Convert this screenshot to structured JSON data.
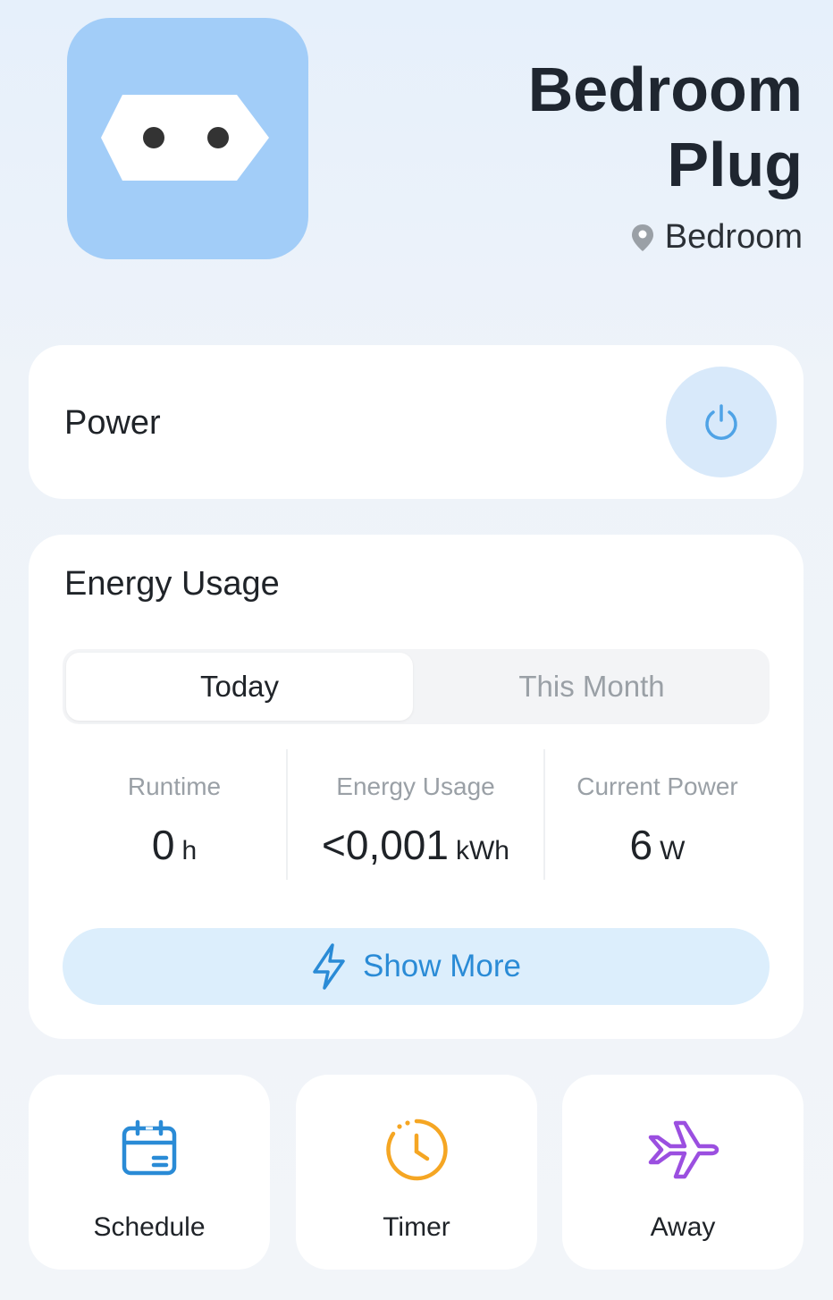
{
  "device": {
    "title_line1": "Bedroom",
    "title_line2": "Plug",
    "location": "Bedroom",
    "icon": "plug-icon",
    "location_icon": "location-pin-icon"
  },
  "power": {
    "label": "Power",
    "icon": "power-icon"
  },
  "energy": {
    "title": "Energy Usage",
    "tabs": [
      {
        "label": "Today",
        "selected": true
      },
      {
        "label": "This Month",
        "selected": false
      }
    ],
    "stats": [
      {
        "label": "Runtime",
        "value": "0",
        "unit": "h"
      },
      {
        "label": "Energy Usage",
        "value": "<0,001",
        "unit": "kWh"
      },
      {
        "label": "Current Power",
        "value": "6",
        "unit": "W"
      }
    ],
    "show_more": "Show More",
    "show_more_icon": "lightning-icon"
  },
  "actions": [
    {
      "label": "Schedule",
      "icon": "calendar-icon",
      "color": "#2a8bd6"
    },
    {
      "label": "Timer",
      "icon": "clock-icon",
      "color": "#f5a623"
    },
    {
      "label": "Away",
      "icon": "airplane-icon",
      "color": "#9b4fe0"
    }
  ],
  "colors": {
    "accent": "#2a8bd6",
    "device_tile": "#a2cdf8",
    "power_button_bg": "#d8e9fa"
  }
}
